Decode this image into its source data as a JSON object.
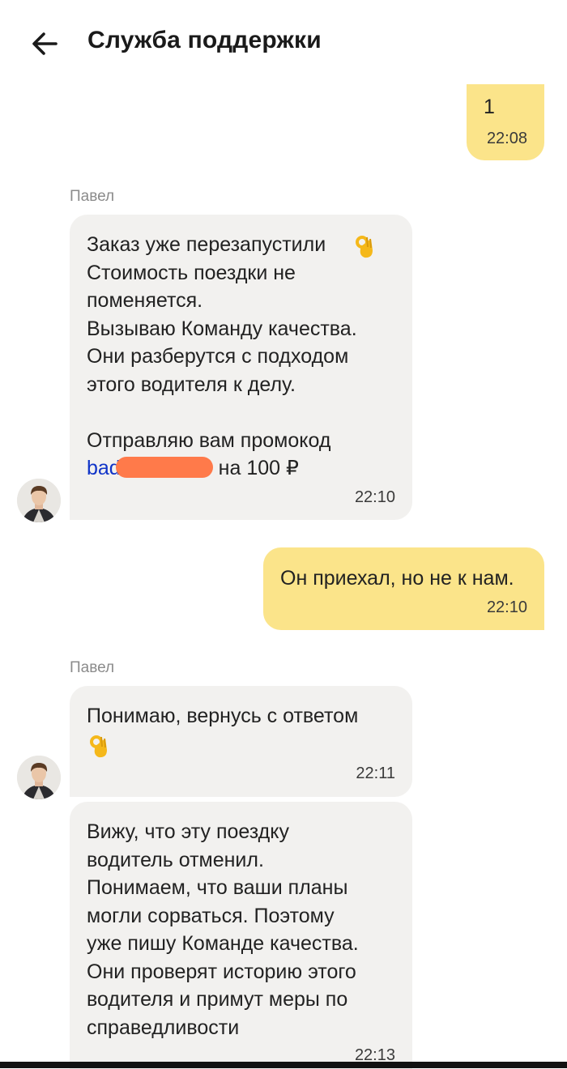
{
  "header": {
    "title": "Служба поддержки",
    "back_icon": "arrow-left-icon"
  },
  "messages": [
    {
      "direction": "out",
      "text": "1",
      "time": "22:08"
    },
    {
      "direction": "in",
      "sender": "Павел",
      "text": "Заказ уже перезапустили\nСтоимость поездки не\nпоменяется.\nВызываю Команду качества.\nОни разберутся с подходом\nэтого водителя к делу.\n\nОтправляю вам промокод",
      "emoji": "ok-hand-emoji",
      "promo_code_visible": "bad",
      "promo_suffix": "на 100 ₽",
      "time": "22:10"
    },
    {
      "direction": "out",
      "text": "Он приехал, но не к нам.",
      "time": "22:10"
    },
    {
      "direction": "in",
      "sender": "Павел",
      "text": "Понимаю, вернусь с ответом",
      "emoji": "ok-hand-emoji",
      "time": "22:11"
    },
    {
      "direction": "in",
      "text": "Вижу, что эту поездку\nводитель отменил.\nПонимаем, что ваши планы\nмогли сорваться. Поэтому\nуже пишу Команде качества.\nОни проверят историю этого\nводителя и примут меры по\nсправедливости",
      "time": "22:13"
    }
  ],
  "colors": {
    "outgoing_bubble": "#fbe48a",
    "incoming_bubble": "#f2f1ef",
    "promo_link": "#1034c8",
    "redaction": "#ff7a4a"
  }
}
